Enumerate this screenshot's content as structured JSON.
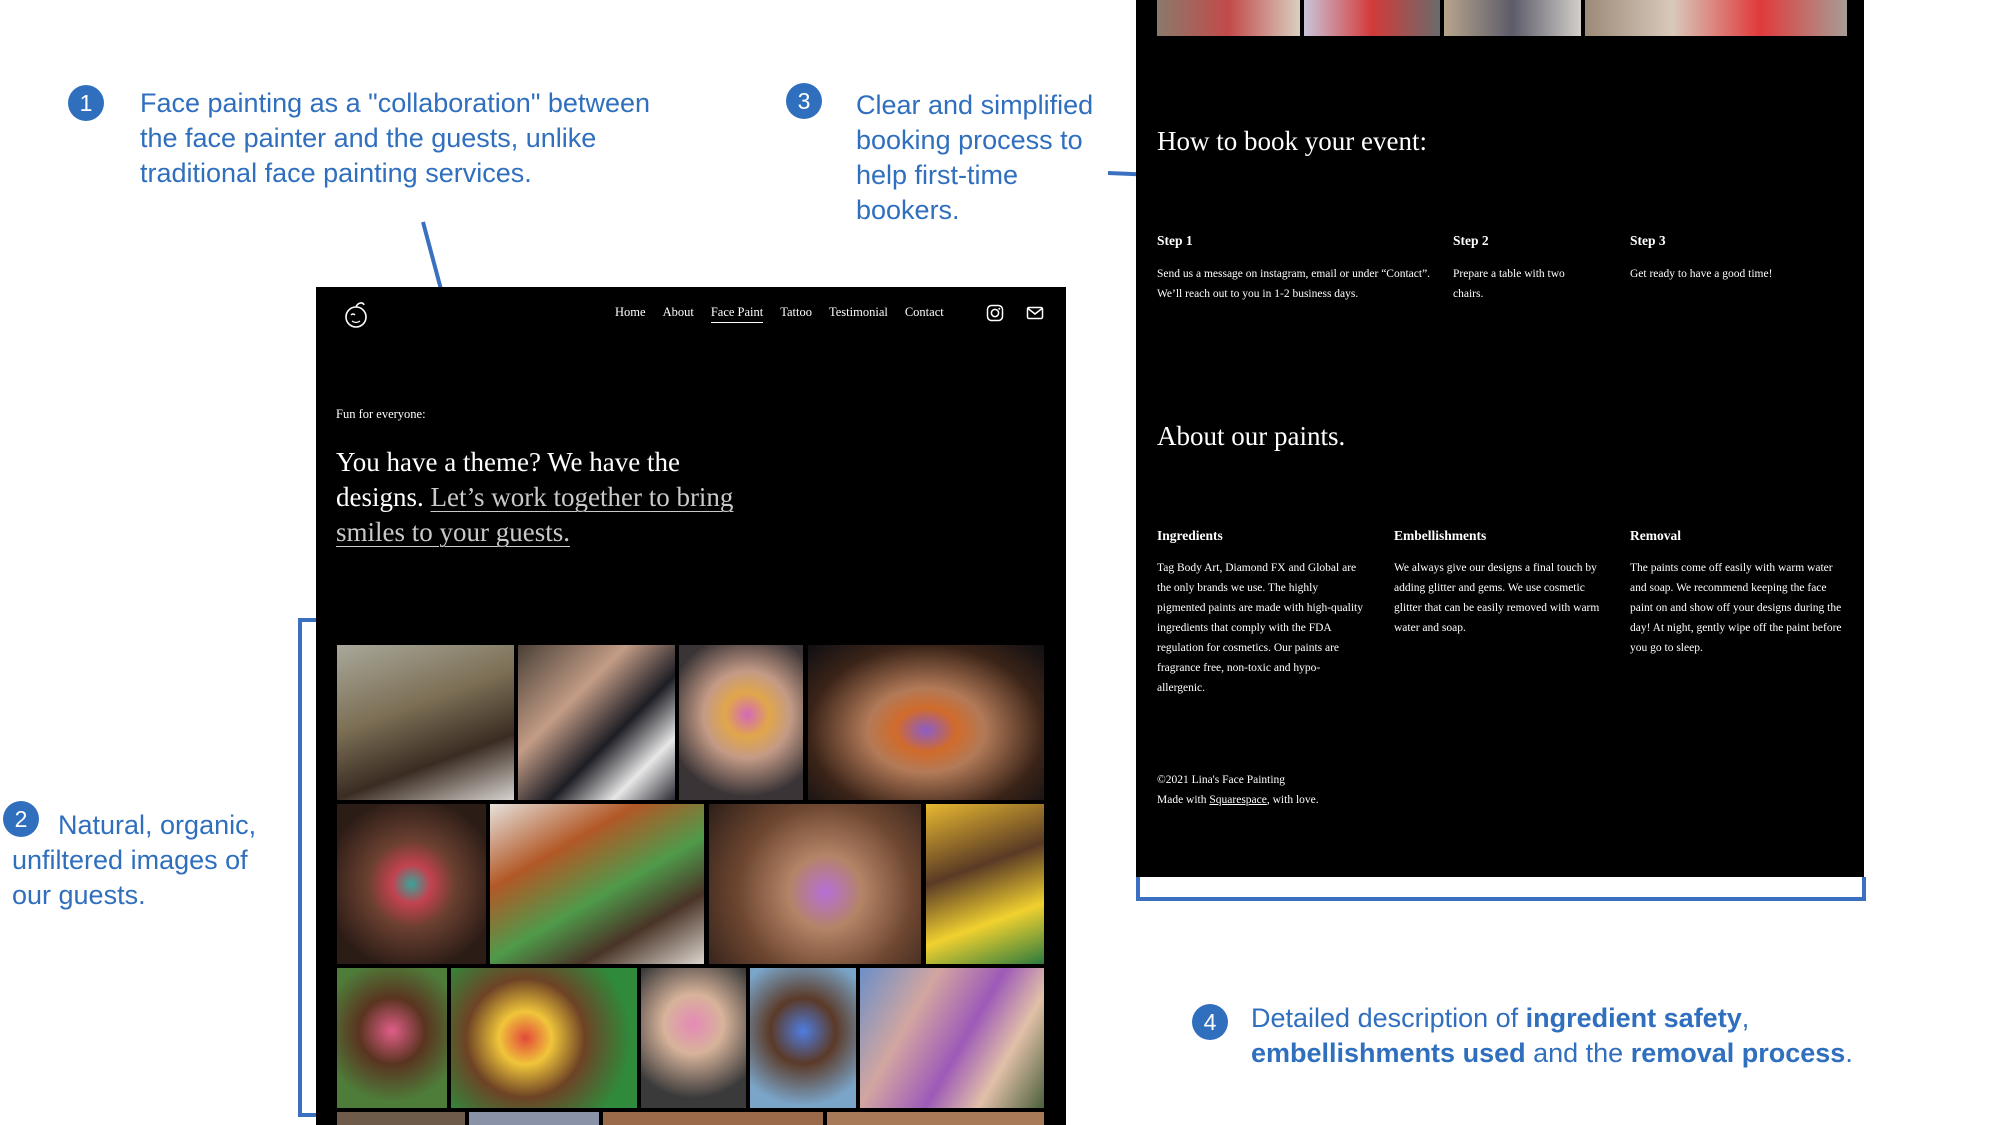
{
  "annotations": [
    {
      "num": "1",
      "text": "Face painting as a \"collaboration\" between the face painter and the guests, unlike traditional face painting services."
    },
    {
      "num": "2",
      "text": "Natural, organic, unfiltered images of our guests."
    },
    {
      "num": "3",
      "text": "Clear and simplified booking process to help first-time bookers."
    },
    {
      "num": "4",
      "text_parts": [
        "Detailed description of ",
        "ingredient safety",
        ", ",
        "embellishments used",
        " and the ",
        "removal process",
        "."
      ]
    }
  ],
  "left_page": {
    "nav": [
      "Home",
      "About",
      "Face Paint",
      "Tattoo",
      "Testimonial",
      "Contact"
    ],
    "kicker": "Fun for everyone:",
    "headline_plain": "You have a theme? We have the designs. ",
    "headline_link": "Let’s work together to bring smiles to your guests."
  },
  "right_page": {
    "book_title": "How to book your event:",
    "steps": [
      {
        "title": "Step 1",
        "body": "Send us a message on instagram, email or under “Contact”. We’ll reach out to you in 1-2 business days."
      },
      {
        "title": "Step 2",
        "body": "Prepare a table with two chairs."
      },
      {
        "title": "Step 3",
        "body": "Get ready to have a good time!"
      }
    ],
    "paints_title": "About our paints.",
    "paints": [
      {
        "title": "Ingredients",
        "body": "Tag Body Art, Diamond FX and Global are the only brands we use. The highly pigmented paints are made with high-quality ingredients that comply with the FDA regulation for cosmetics. Our paints are fragrance free, non-toxic and hypo-allergenic."
      },
      {
        "title": "Embellishments",
        "body": "We always give our designs a final touch by adding glitter and gems. We use cosmetic glitter that can be easily removed with warm water and soap."
      },
      {
        "title": "Removal",
        "body": "The paints come off easily with warm water and soap. We recommend keeping the face paint on and show off your designs during the day! At night, gently wipe off the paint before you go to sleep."
      }
    ],
    "footer_line1": "©2021 Lina's Face Painting",
    "footer_made": "Made with ",
    "footer_link": "Squarespace",
    "footer_end": ", with love."
  },
  "colors": {
    "annotation": "#2f6fbe",
    "page_bg": "#000000"
  }
}
